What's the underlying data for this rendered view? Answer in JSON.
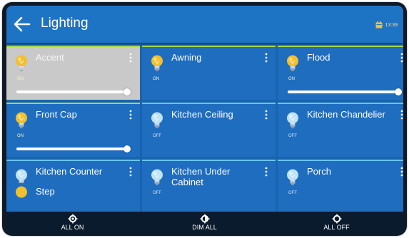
{
  "header": {
    "back_icon": "arrow-left-icon",
    "title": "Lighting",
    "status_icon": "calendar-icon",
    "time": "13:39"
  },
  "colors": {
    "appbar": "#1d73c4",
    "tile": "#1f6dbf",
    "tile_selected": "#c9c9c9",
    "on_accent": "#a8d94d",
    "off_accent": "#66c6f2",
    "bulb_on": "#f2c02e",
    "bulb_off": "#bfe3f7"
  },
  "lights": [
    {
      "name": "Accent",
      "state": "ON",
      "on": true,
      "selected": true,
      "level": 0.97
    },
    {
      "name": "Awning",
      "state": "ON",
      "on": true,
      "selected": false
    },
    {
      "name": "Flood",
      "state": "ON",
      "on": true,
      "selected": false,
      "level": 0.97
    },
    {
      "name": "Front Cap",
      "state": "ON",
      "on": true,
      "selected": false,
      "level": 0.97
    },
    {
      "name": "Kitchen Ceiling",
      "state": "OFF",
      "on": false,
      "selected": false
    },
    {
      "name": "Kitchen Chandelier",
      "state": "OFF",
      "on": false,
      "selected": false
    },
    {
      "name": "Kitchen Counter",
      "state": "OFF",
      "on": false,
      "selected": false
    },
    {
      "name": "Kitchen Under Cabinet",
      "state": "OFF",
      "on": false,
      "selected": false
    },
    {
      "name": "Porch",
      "state": "OFF",
      "on": false,
      "selected": false
    }
  ],
  "partial_tile": {
    "name": "Step"
  },
  "actions": [
    {
      "label": "ALL ON",
      "icon": "light-on-icon"
    },
    {
      "label": "DIM ALL",
      "icon": "dim-icon"
    },
    {
      "label": "ALL OFF",
      "icon": "light-off-icon"
    }
  ]
}
